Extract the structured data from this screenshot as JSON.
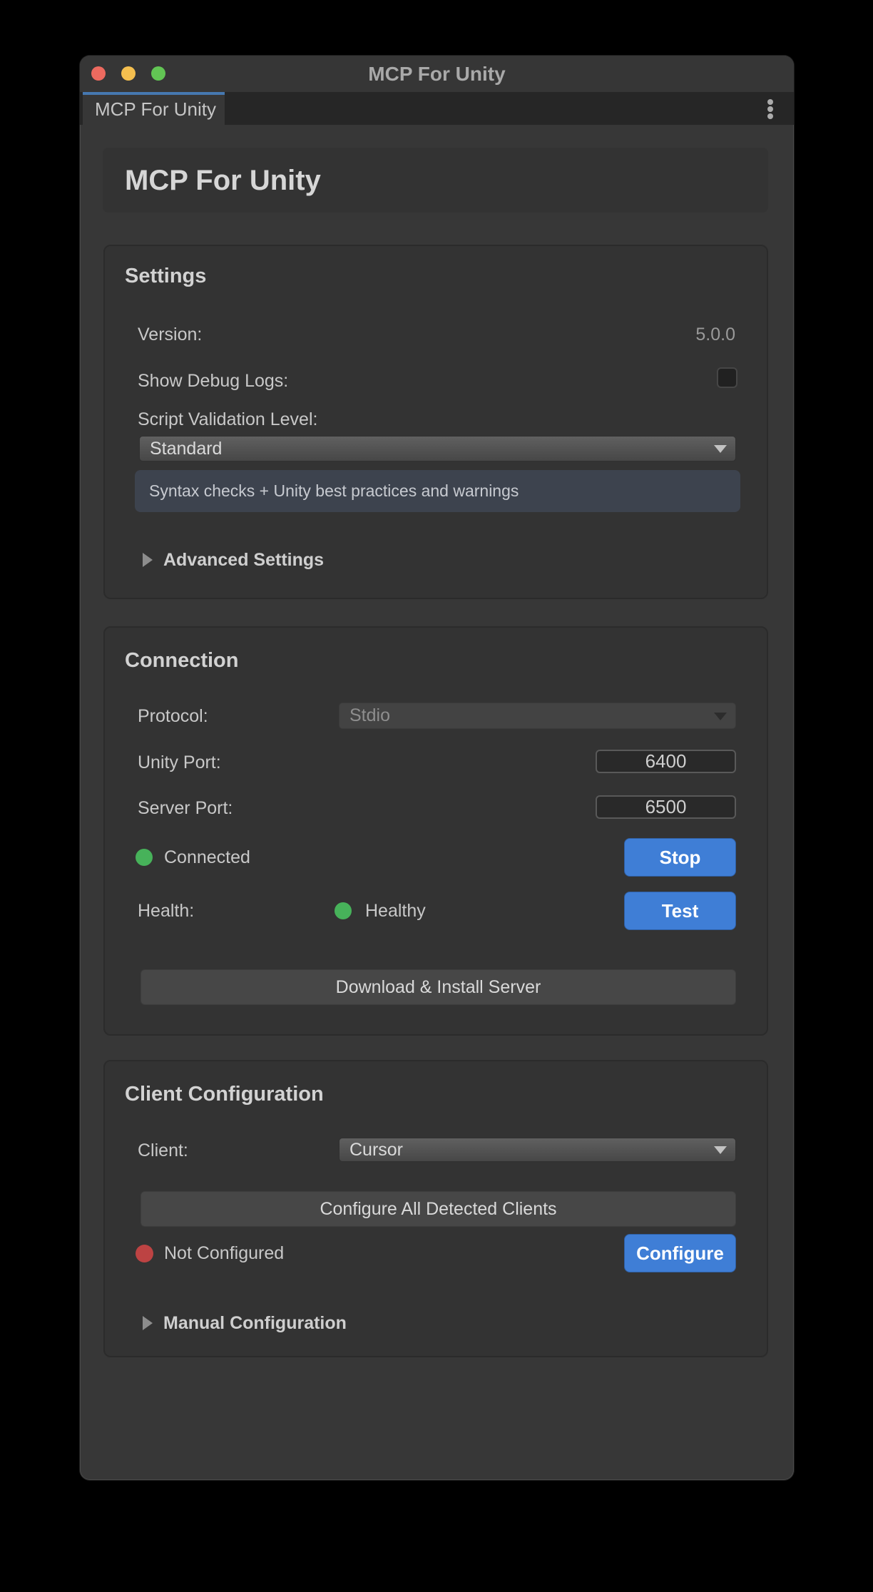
{
  "window": {
    "title": "MCP For Unity"
  },
  "tabbar": {
    "active_tab": "MCP For Unity",
    "menu_icon": "kebab-menu-icon"
  },
  "header": {
    "title": "MCP For Unity"
  },
  "settings": {
    "title": "Settings",
    "version_label": "Version:",
    "version_value": "5.0.0",
    "debug_label": "Show Debug Logs:",
    "debug_checked": false,
    "validation_label": "Script Validation Level:",
    "validation_value": "Standard",
    "validation_help": "Syntax checks + Unity best practices and warnings",
    "advanced_label": "Advanced Settings"
  },
  "connection": {
    "title": "Connection",
    "protocol_label": "Protocol:",
    "protocol_value": "Stdio",
    "unity_port_label": "Unity Port:",
    "unity_port_value": "6400",
    "server_port_label": "Server Port:",
    "server_port_value": "6500",
    "status_text": "Connected",
    "stop_label": "Stop",
    "health_label": "Health:",
    "health_value": "Healthy",
    "test_label": "Test",
    "download_label": "Download & Install Server"
  },
  "client": {
    "title": "Client Configuration",
    "client_label": "Client:",
    "client_value": "Cursor",
    "configure_all_label": "Configure All Detected Clients",
    "status_text": "Not Configured",
    "configure_label": "Configure",
    "manual_label": "Manual Configuration"
  },
  "colors": {
    "window_bg": "#373737",
    "card_bg": "#333333",
    "tab_accent_blue": "#4678b1",
    "helpbox_bg": "#3d434e",
    "action_blue": "#3f7ed6",
    "status_green": "#47b25a",
    "status_red": "#bd4343",
    "traffic_red": "#ed6a5f",
    "traffic_yellow": "#f5bf4f",
    "traffic_green": "#62c554"
  }
}
